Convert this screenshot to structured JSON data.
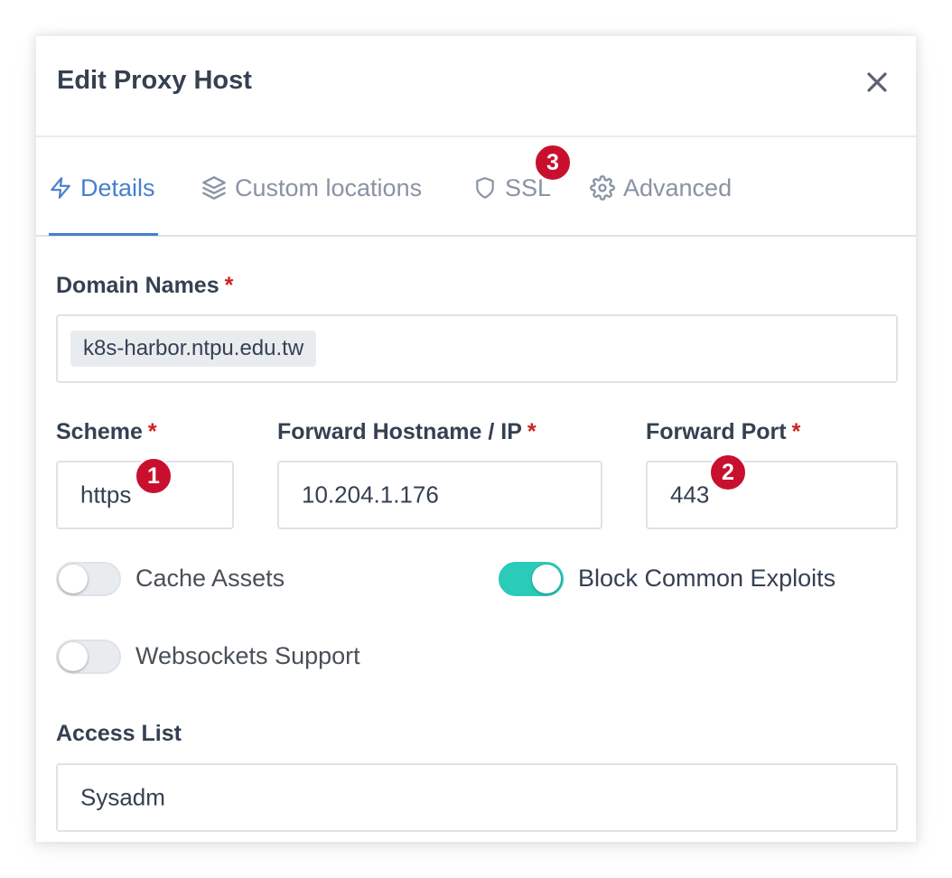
{
  "modal": {
    "title": "Edit Proxy Host"
  },
  "tabs": [
    {
      "label": "Details",
      "icon": "lightning-icon",
      "active": true
    },
    {
      "label": "Custom locations",
      "icon": "layers-icon",
      "active": false
    },
    {
      "label": "SSL",
      "icon": "shield-icon",
      "active": false
    },
    {
      "label": "Advanced",
      "icon": "gear-icon",
      "active": false
    }
  ],
  "annotations": {
    "badge1": "1",
    "badge2": "2",
    "badge3": "3"
  },
  "form": {
    "domain_names": {
      "label": "Domain Names",
      "required": "*",
      "values": [
        "k8s-harbor.ntpu.edu.tw"
      ]
    },
    "scheme": {
      "label": "Scheme",
      "required": "*",
      "value": "https"
    },
    "forward_host": {
      "label": "Forward Hostname / IP",
      "required": "*",
      "value": "10.204.1.176"
    },
    "forward_port": {
      "label": "Forward Port",
      "required": "*",
      "value": "443"
    },
    "cache_assets": {
      "label": "Cache Assets",
      "enabled": false
    },
    "block_exploits": {
      "label": "Block Common Exploits",
      "enabled": true
    },
    "websockets": {
      "label": "Websockets Support",
      "enabled": false
    },
    "access_list": {
      "label": "Access List",
      "value": "Sysadm"
    }
  },
  "colors": {
    "accent": "#467fcf",
    "toggle_on": "#2bcbba",
    "badge": "#c8102e",
    "required": "#cd201f"
  }
}
